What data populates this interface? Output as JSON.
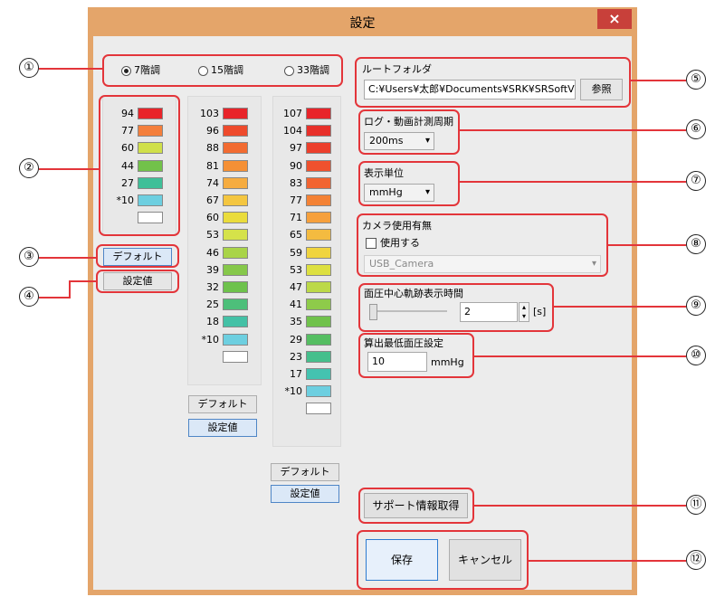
{
  "window": {
    "title": "設定",
    "close_glyph": "×"
  },
  "gradation": {
    "options": [
      {
        "label": "7階調",
        "selected": true
      },
      {
        "label": "15階調",
        "selected": false
      },
      {
        "label": "33階調",
        "selected": false
      }
    ]
  },
  "scale7": {
    "rows": [
      {
        "value": "94",
        "color": "#e8242a"
      },
      {
        "value": "77",
        "color": "#f47f3c"
      },
      {
        "value": "60",
        "color": "#d0e04a"
      },
      {
        "value": "44",
        "color": "#72c24a"
      },
      {
        "value": "27",
        "color": "#3fbf98"
      },
      {
        "value": "*10",
        "color": "#6dcfe0"
      },
      {
        "value": "",
        "color": "#ffffff"
      }
    ],
    "default_label": "デフォルト",
    "setting_label": "設定値"
  },
  "scale15": {
    "rows": [
      {
        "value": "103",
        "color": "#e8242a"
      },
      {
        "value": "96",
        "color": "#ee4a2c"
      },
      {
        "value": "88",
        "color": "#f26b31"
      },
      {
        "value": "81",
        "color": "#f59035"
      },
      {
        "value": "74",
        "color": "#f6ac40"
      },
      {
        "value": "67",
        "color": "#f4c640"
      },
      {
        "value": "60",
        "color": "#eadc3c"
      },
      {
        "value": "53",
        "color": "#d5e24a"
      },
      {
        "value": "46",
        "color": "#a9d448"
      },
      {
        "value": "39",
        "color": "#86c84a"
      },
      {
        "value": "32",
        "color": "#6ec24c"
      },
      {
        "value": "25",
        "color": "#4dbf7a"
      },
      {
        "value": "18",
        "color": "#44c1a6"
      },
      {
        "value": "*10",
        "color": "#6dcfe0"
      },
      {
        "value": "",
        "color": "#ffffff"
      }
    ],
    "default_label": "デフォルト",
    "setting_label": "設定値"
  },
  "scale33": {
    "rows": [
      {
        "value": "107",
        "color": "#e8242a"
      },
      {
        "value": "104",
        "color": "#e8302a"
      },
      {
        "value": "97",
        "color": "#ec3f2c"
      },
      {
        "value": "90",
        "color": "#ef512e"
      },
      {
        "value": "83",
        "color": "#f26431"
      },
      {
        "value": "77",
        "color": "#f48235"
      },
      {
        "value": "71",
        "color": "#f6a03c"
      },
      {
        "value": "65",
        "color": "#f4bb40"
      },
      {
        "value": "59",
        "color": "#f0d43e"
      },
      {
        "value": "53",
        "color": "#dde040"
      },
      {
        "value": "47",
        "color": "#bcd948"
      },
      {
        "value": "41",
        "color": "#8ecb4a"
      },
      {
        "value": "35",
        "color": "#70c24b"
      },
      {
        "value": "29",
        "color": "#55be62"
      },
      {
        "value": "23",
        "color": "#45bf8c"
      },
      {
        "value": "17",
        "color": "#44c3b0"
      },
      {
        "value": "*10",
        "color": "#6dcfe0"
      },
      {
        "value": "",
        "color": "#ffffff"
      }
    ],
    "default_label": "デフォルト",
    "setting_label": "設定値"
  },
  "root_folder": {
    "label": "ルートフォルダ",
    "path": "C:¥Users¥太郎¥Documents¥SRK¥SRSoftVisi",
    "browse_label": "参照"
  },
  "log_period": {
    "label": "ログ・動画計測周期",
    "value": "200ms"
  },
  "display_unit": {
    "label": "表示単位",
    "value": "mmHg"
  },
  "camera": {
    "label": "カメラ使用有無",
    "use_label": "使用する",
    "device": "USB_Camera"
  },
  "trajectory": {
    "label": "面圧中心軌跡表示時間",
    "value": "2",
    "unit": "[s]"
  },
  "min_pressure": {
    "label": "算出最低面圧設定",
    "value": "10",
    "unit": "mmHg"
  },
  "support_button": "サポート情報取得",
  "save_button": "保存",
  "cancel_button": "キャンセル",
  "callouts": [
    "①",
    "②",
    "③",
    "④",
    "⑤",
    "⑥",
    "⑦",
    "⑧",
    "⑨",
    "⑩",
    "⑪",
    "⑫"
  ],
  "icons": {
    "dropdown": "▾",
    "spin_up": "▴",
    "spin_down": "▾"
  }
}
